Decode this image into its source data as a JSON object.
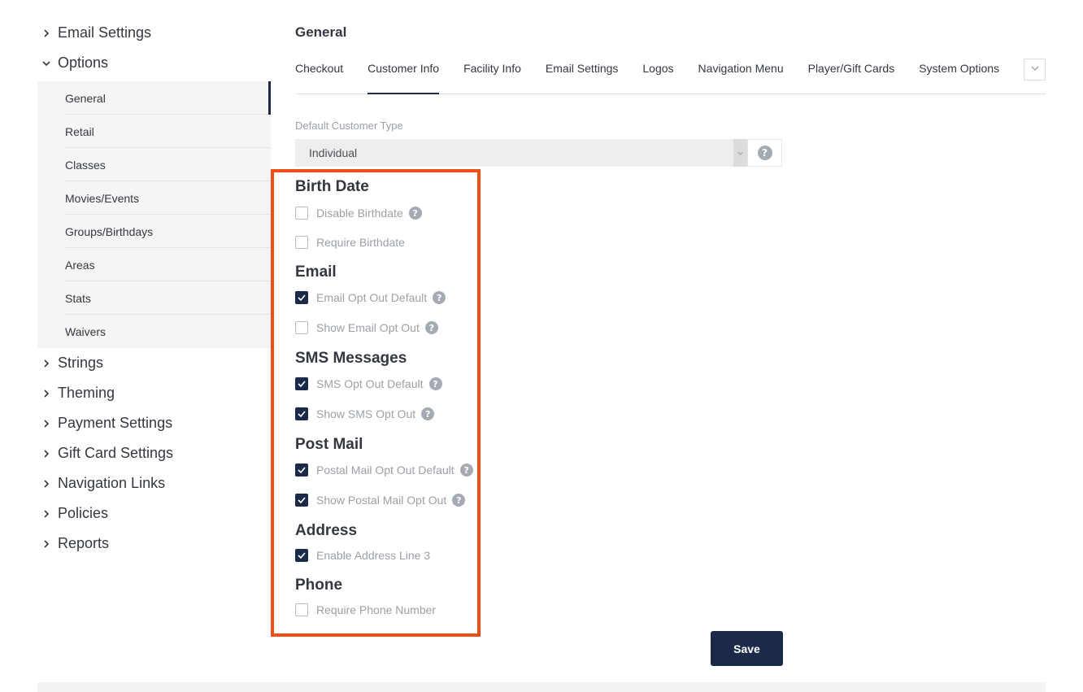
{
  "sidebar": {
    "items_top": [
      {
        "label": "Email Settings",
        "expanded": false
      },
      {
        "label": "Options",
        "expanded": true
      }
    ],
    "options_subitems": [
      {
        "label": "General",
        "active": true
      },
      {
        "label": "Retail"
      },
      {
        "label": "Classes"
      },
      {
        "label": "Movies/Events"
      },
      {
        "label": "Groups/Birthdays"
      },
      {
        "label": "Areas"
      },
      {
        "label": "Stats"
      },
      {
        "label": "Waivers"
      }
    ],
    "items_bottom": [
      {
        "label": "Strings"
      },
      {
        "label": "Theming"
      },
      {
        "label": "Payment Settings"
      },
      {
        "label": "Gift Card Settings"
      },
      {
        "label": "Navigation Links"
      },
      {
        "label": "Policies"
      },
      {
        "label": "Reports"
      }
    ]
  },
  "main": {
    "title": "General",
    "tabs": [
      {
        "label": "Checkout"
      },
      {
        "label": "Customer Info",
        "active": true
      },
      {
        "label": "Facility Info"
      },
      {
        "label": "Email Settings"
      },
      {
        "label": "Logos"
      },
      {
        "label": "Navigation Menu"
      },
      {
        "label": "Player/Gift Cards"
      },
      {
        "label": "System Options"
      }
    ],
    "default_customer_type": {
      "label": "Default Customer Type",
      "value": "Individual",
      "help": "?"
    }
  },
  "options": {
    "birth_date": {
      "title": "Birth Date",
      "disable_birthdate": {
        "label": "Disable Birthdate",
        "checked": false,
        "help": "?"
      },
      "require_birthdate": {
        "label": "Require Birthdate",
        "checked": false
      }
    },
    "email": {
      "title": "Email",
      "email_opt_out_default": {
        "label": "Email Opt Out Default",
        "checked": true,
        "help": "?"
      },
      "show_email_opt_out": {
        "label": "Show Email Opt Out",
        "checked": false,
        "help": "?"
      }
    },
    "sms": {
      "title": "SMS Messages",
      "sms_opt_out_default": {
        "label": "SMS Opt Out Default",
        "checked": true,
        "help": "?"
      },
      "show_sms_opt_out": {
        "label": "Show SMS Opt Out",
        "checked": true,
        "help": "?"
      }
    },
    "post_mail": {
      "title": "Post Mail",
      "postal_mail_opt_out_default": {
        "label": "Postal Mail Opt Out Default",
        "checked": true,
        "help": "?"
      },
      "show_postal_mail_opt_out": {
        "label": "Show Postal Mail Opt Out",
        "checked": true,
        "help": "?"
      }
    },
    "address": {
      "title": "Address",
      "enable_address_line_3": {
        "label": "Enable Address Line 3",
        "checked": true
      }
    },
    "phone": {
      "title": "Phone",
      "require_phone_number": {
        "label": "Require Phone Number",
        "checked": false
      }
    }
  },
  "actions": {
    "save_label": "Save"
  },
  "colors": {
    "primary": "#1b2a48",
    "highlight": "#f04e16",
    "muted_text": "#9aa0a6"
  }
}
